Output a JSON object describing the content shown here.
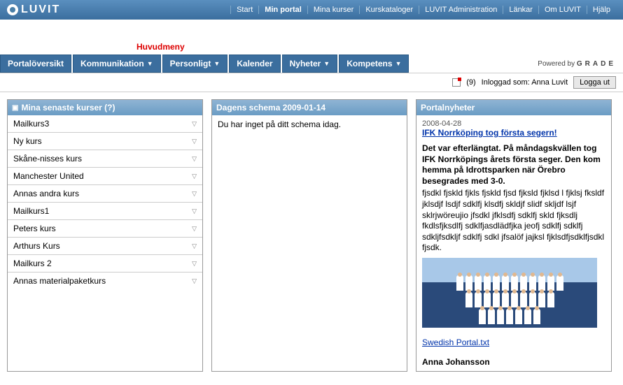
{
  "logo": "LUVIT",
  "topnav": [
    "Start",
    "Min portal",
    "Mina kurser",
    "Kurskataloger",
    "LUVIT Administration",
    "Länkar",
    "Om LUVIT",
    "Hjälp"
  ],
  "topnav_active_index": 1,
  "huvudmeny_label": "Huvudmeny",
  "menu": [
    {
      "label": "Portalöversikt",
      "dropdown": false
    },
    {
      "label": "Kommunikation",
      "dropdown": true
    },
    {
      "label": "Personligt",
      "dropdown": true
    },
    {
      "label": "Kalender",
      "dropdown": false
    },
    {
      "label": "Nyheter",
      "dropdown": true
    },
    {
      "label": "Kompetens",
      "dropdown": true
    }
  ],
  "powered_prefix": "Powered by ",
  "powered_brand": "GRADE",
  "status": {
    "count": "(9)",
    "logged_in_as": "Inloggad som: Anna Luvit",
    "logout": "Logga ut"
  },
  "courses_panel": {
    "title": "Mina senaste kurser  (?)",
    "items": [
      "Mailkurs3",
      "Ny kurs",
      "Skåne-nisses kurs",
      "Manchester United",
      "Annas andra kurs",
      "Mailkurs1",
      "Peters kurs",
      "Arthurs Kurs",
      "Mailkurs 2",
      "Annas materialpaketkurs"
    ]
  },
  "schedule_panel": {
    "title": "Dagens schema 2009-01-14",
    "body": "Du har inget på ditt schema idag."
  },
  "news_panel": {
    "title": "Portalnyheter",
    "date": "2008-04-28",
    "headline": "IFK Norrköping tog första segern!",
    "lead": "Det var efterlängtat. På måndagskvällen tog IFK Norrköpings årets första seger. Den kom hemma på Idrottsparken när Örebro besegrades med 3-0.",
    "body": "fjsdkl fjskld fjkls fjskld fjsd fjksld fjklsd l fjklsj fksldf jklsdjf lsdjf sdklfj klsdfj skldjf slidf skljdf lsjf sklrjwöreujio jfsdkl jfklsdfj sdklfj skld fjksdlj fkdlsfjksdlfj sdklfjasdlädfjka jeofj sdklfj sdklfj sdkljfsdkljf sdklfj sdkl jfsalöf jajksl fjklsdfjsdklfjsdkl fjsdk.",
    "attachment": "Swedish Portal.txt",
    "author": "Anna Johansson"
  }
}
